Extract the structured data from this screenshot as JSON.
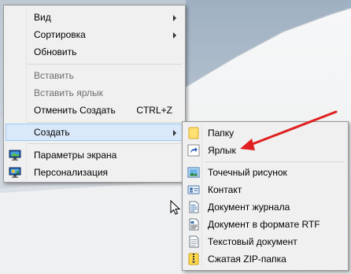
{
  "context_menu": {
    "items": [
      {
        "label": "Вид",
        "has_submenu": true
      },
      {
        "label": "Сортировка",
        "has_submenu": true
      },
      {
        "label": "Обновить"
      },
      {
        "label": "Вставить",
        "disabled": true
      },
      {
        "label": "Вставить ярлык",
        "disabled": true
      },
      {
        "label": "Отменить Создать",
        "shortcut": "CTRL+Z"
      },
      {
        "label": "Создать",
        "has_submenu": true,
        "highlighted": true
      },
      {
        "label": "Параметры экрана",
        "icon": "display-settings-icon"
      },
      {
        "label": "Персонализация",
        "icon": "personalization-icon"
      }
    ]
  },
  "create_submenu": {
    "items": [
      {
        "label": "Папку",
        "icon": "folder-icon"
      },
      {
        "label": "Ярлык",
        "icon": "shortcut-icon"
      },
      {
        "label": "Точечный рисунок",
        "icon": "bitmap-image-icon"
      },
      {
        "label": "Контакт",
        "icon": "contact-card-icon"
      },
      {
        "label": "Документ журнала",
        "icon": "journal-document-icon"
      },
      {
        "label": "Документ в формате RTF",
        "icon": "rtf-document-icon"
      },
      {
        "label": "Текстовый документ",
        "icon": "text-document-icon"
      },
      {
        "label": "Сжатая ZIP-папка",
        "icon": "zip-folder-icon"
      }
    ]
  },
  "annotation": {
    "color": "#e02020"
  }
}
